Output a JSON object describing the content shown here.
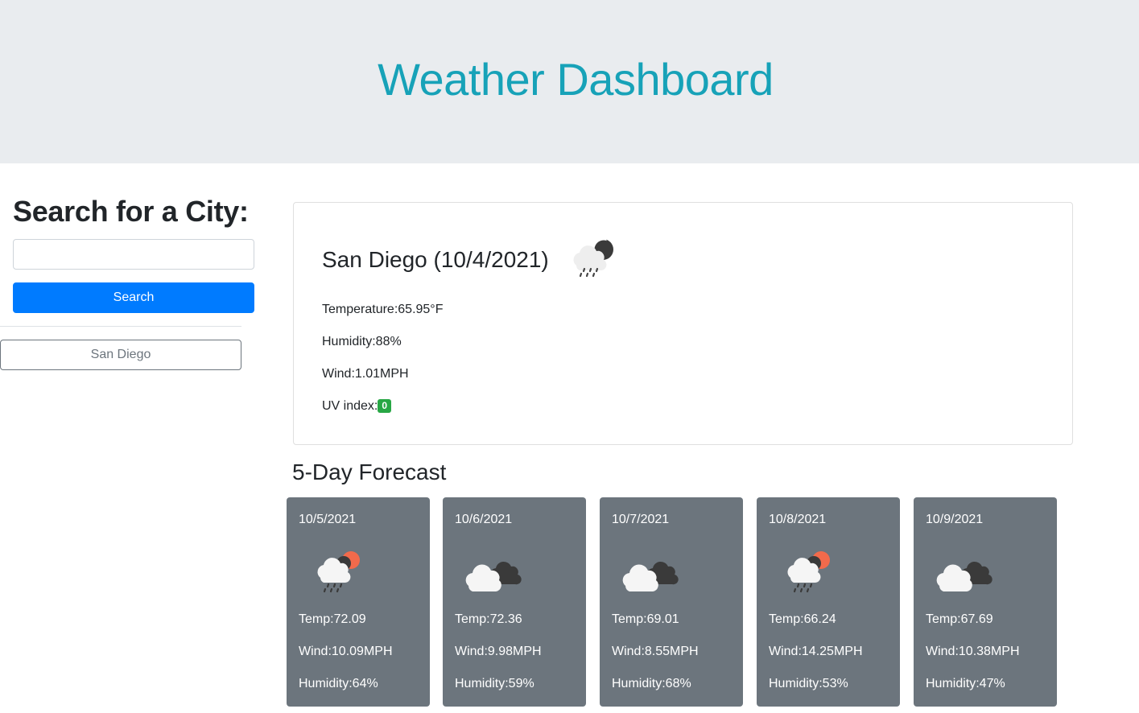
{
  "header": {
    "title": "Weather Dashboard"
  },
  "search": {
    "heading": "Search for a City:",
    "input_value": "",
    "placeholder": "",
    "button_label": "Search"
  },
  "history": [
    "San Diego"
  ],
  "current": {
    "city_heading": "San Diego (10/4/2021)",
    "icon": "rain-night-icon",
    "temperature": "Temperature:65.95°F",
    "humidity": "Humidity:88%",
    "wind": "Wind:1.01MPH",
    "uv_label": "UV index:",
    "uv_value": "0",
    "uv_color": "#28a745"
  },
  "forecast": {
    "heading": "5-Day Forecast",
    "days": [
      {
        "date": "10/5/2021",
        "icon": "rain-sun-icon",
        "temp": "Temp:72.09",
        "wind": "Wind:10.09MPH",
        "humidity": "Humidity:64%"
      },
      {
        "date": "10/6/2021",
        "icon": "broken-clouds-icon",
        "temp": "Temp:72.36",
        "wind": "Wind:9.98MPH",
        "humidity": "Humidity:59%"
      },
      {
        "date": "10/7/2021",
        "icon": "broken-clouds-icon",
        "temp": "Temp:69.01",
        "wind": "Wind:8.55MPH",
        "humidity": "Humidity:68%"
      },
      {
        "date": "10/8/2021",
        "icon": "rain-sun-icon",
        "temp": "Temp:66.24",
        "wind": "Wind:14.25MPH",
        "humidity": "Humidity:53%"
      },
      {
        "date": "10/9/2021",
        "icon": "broken-clouds-icon",
        "temp": "Temp:67.69",
        "wind": "Wind:10.38MPH",
        "humidity": "Humidity:47%"
      }
    ]
  },
  "colors": {
    "title": "#17a2b8",
    "primary": "#007bff",
    "card": "#6c757d",
    "jumbotron": "#e9ecef"
  }
}
